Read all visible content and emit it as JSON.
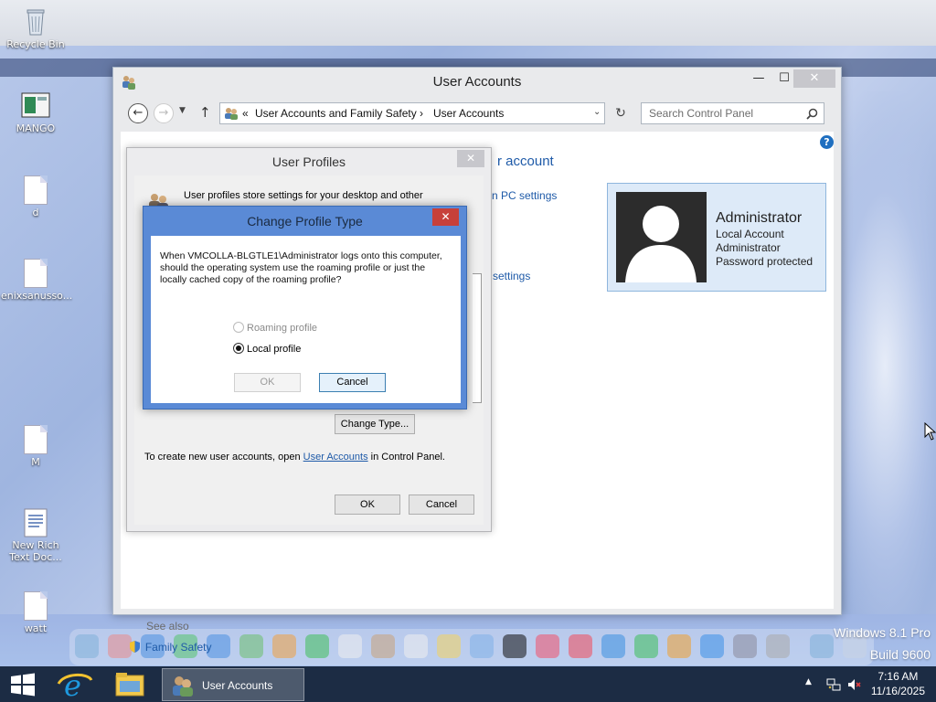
{
  "desktop": {
    "icons": [
      {
        "label": "Recycle Bin"
      },
      {
        "label": "MANGO"
      },
      {
        "label": "d"
      },
      {
        "label": "enixsanusso..."
      },
      {
        "label": "M"
      },
      {
        "label": "New Rich Text Doc..."
      },
      {
        "label": "watt"
      }
    ],
    "watermark_line1": "Windows 8.1 Pro",
    "watermark_line2": "Build 9600"
  },
  "window": {
    "title": "User Accounts",
    "controls": {
      "minimize": "—",
      "maximize": "☐",
      "close": "✕"
    },
    "address": {
      "chevrons": "«",
      "crumb1": "User Accounts and Family Safety",
      "separator": "›",
      "crumb2": "User Accounts"
    },
    "search_placeholder": "Search Control Panel",
    "help_glyph": "?",
    "heading_partial": "r account",
    "link_partial_1": "n PC settings",
    "link_partial_2": "settings",
    "account": {
      "name": "Administrator",
      "type": "Local Account",
      "role": "Administrator",
      "status": "Password protected"
    },
    "see_also": "See also",
    "family_safety": "Family Safety"
  },
  "user_profiles": {
    "title": "User Profiles",
    "close": "✕",
    "description": "User profiles store settings for your desktop and other",
    "change_type_button": "Change Type...",
    "create_text_before": "To create new user accounts, open ",
    "create_link": "User Accounts",
    "create_text_after": " in Control Panel.",
    "ok": "OK",
    "cancel": "Cancel"
  },
  "change_profile_type": {
    "title": "Change Profile Type",
    "close": "✕",
    "message": "When VMCOLLA-BLGTLE1\\Administrator logs onto this computer, should the operating system use the roaming profile or just the locally cached copy of the roaming profile?",
    "options": [
      {
        "label": "Roaming profile",
        "selected": false,
        "enabled": false
      },
      {
        "label": "Local profile",
        "selected": true,
        "enabled": true
      }
    ],
    "ok": "OK",
    "cancel": "Cancel"
  },
  "taskbar": {
    "active_task": "User Accounts",
    "time": "7:16 AM",
    "date": "11/16/2025"
  },
  "colors": {
    "taskbar": "#1c2c44",
    "link": "#1e5aa8",
    "dialog_frame": "#5a8ad6",
    "close_red": "#c7403a"
  }
}
